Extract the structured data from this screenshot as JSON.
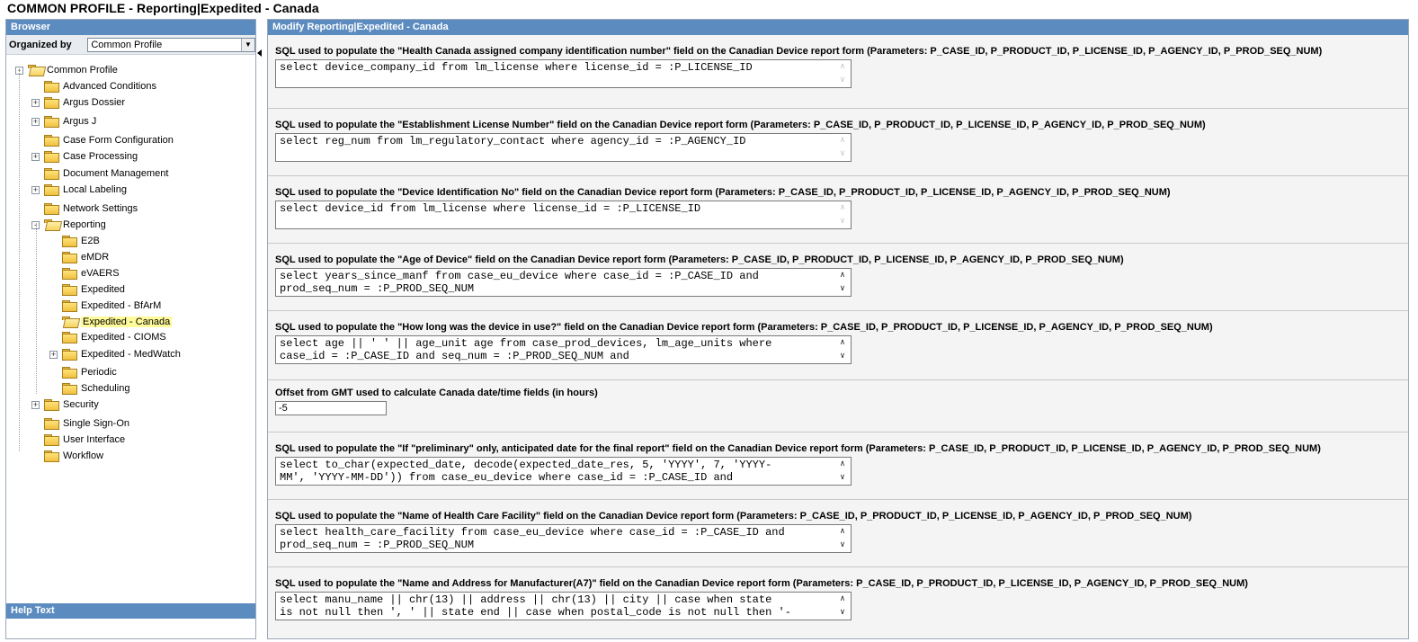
{
  "page_title": "COMMON PROFILE - Reporting|Expedited - Canada",
  "browser": {
    "header": "Browser",
    "organized_by_label": "Organized by",
    "organized_by_value": "Common Profile",
    "tree": [
      {
        "label": "Common Profile",
        "level": 0,
        "expander": "-",
        "open": true
      },
      {
        "label": "Advanced Conditions",
        "level": 1,
        "expander": ""
      },
      {
        "label": "Argus Dossier",
        "level": 1,
        "expander": "+"
      },
      {
        "label": "Argus J",
        "level": 1,
        "expander": "+"
      },
      {
        "label": "Case Form Configuration",
        "level": 1,
        "expander": ""
      },
      {
        "label": "Case Processing",
        "level": 1,
        "expander": "+"
      },
      {
        "label": "Document Management",
        "level": 1,
        "expander": ""
      },
      {
        "label": "Local Labeling",
        "level": 1,
        "expander": "+"
      },
      {
        "label": "Network Settings",
        "level": 1,
        "expander": ""
      },
      {
        "label": "Reporting",
        "level": 1,
        "expander": "-",
        "open": true
      },
      {
        "label": "E2B",
        "level": 2,
        "expander": ""
      },
      {
        "label": "eMDR",
        "level": 2,
        "expander": ""
      },
      {
        "label": "eVAERS",
        "level": 2,
        "expander": ""
      },
      {
        "label": "Expedited",
        "level": 2,
        "expander": ""
      },
      {
        "label": "Expedited - BfArM",
        "level": 2,
        "expander": ""
      },
      {
        "label": "Expedited - Canada",
        "level": 2,
        "expander": "",
        "open": true,
        "selected": true
      },
      {
        "label": "Expedited - CIOMS",
        "level": 2,
        "expander": ""
      },
      {
        "label": "Expedited - MedWatch",
        "level": 2,
        "expander": "+"
      },
      {
        "label": "Periodic",
        "level": 2,
        "expander": ""
      },
      {
        "label": "Scheduling",
        "level": 2,
        "expander": ""
      },
      {
        "label": "Security",
        "level": 1,
        "expander": "+"
      },
      {
        "label": "Single Sign-On",
        "level": 1,
        "expander": ""
      },
      {
        "label": "User Interface",
        "level": 1,
        "expander": ""
      },
      {
        "label": "Workflow",
        "level": 1,
        "expander": ""
      }
    ],
    "help_header": "Help Text"
  },
  "main": {
    "header": "Modify Reporting|Expedited - Canada",
    "sections": [
      {
        "label": "SQL used to populate the \"Health Canada assigned company identification number\" field on the Canadian Device report form (Parameters: P_CASE_ID, P_PRODUCT_ID, P_LICENSE_ID, P_AGENCY_ID, P_PROD_SEQ_NUM)",
        "value": "select device_company_id from lm_license where license_id = :P_LICENSE_ID",
        "scroll": "disabled"
      },
      {
        "label": "SQL used to populate the \"Establishment License Number\" field on the Canadian Device report form (Parameters: P_CASE_ID, P_PRODUCT_ID, P_LICENSE_ID, P_AGENCY_ID, P_PROD_SEQ_NUM)",
        "value": "select reg_num from lm_regulatory_contact where agency_id = :P_AGENCY_ID",
        "scroll": "disabled"
      },
      {
        "label": "SQL used to populate the \"Device Identification No\" field on the Canadian Device report form (Parameters: P_CASE_ID, P_PRODUCT_ID, P_LICENSE_ID, P_AGENCY_ID, P_PROD_SEQ_NUM)",
        "value": "select device_id from lm_license where license_id = :P_LICENSE_ID",
        "scroll": "disabled"
      },
      {
        "label": "SQL used to populate the \"Age of Device\" field on the Canadian Device report form (Parameters: P_CASE_ID, P_PRODUCT_ID, P_LICENSE_ID, P_AGENCY_ID, P_PROD_SEQ_NUM)",
        "value": "select years_since_manf from case_eu_device where case_id = :P_CASE_ID and\nprod_seq_num = :P_PROD_SEQ_NUM",
        "scroll": "enabled"
      },
      {
        "label": "SQL used to populate the \"How long was the device in use?\" field on the Canadian Device report form (Parameters: P_CASE_ID, P_PRODUCT_ID, P_LICENSE_ID, P_AGENCY_ID, P_PROD_SEQ_NUM)",
        "value": "select age || ' ' || age_unit age from case_prod_devices, lm_age_units where\ncase_id = :P_CASE_ID and seq_num = :P_PROD_SEQ_NUM and",
        "scroll": "enabled"
      },
      {
        "label": "Offset from GMT used to calculate Canada date/time fields (in hours)",
        "value": "-5",
        "type": "input"
      },
      {
        "label": "SQL used to populate the \"If \"preliminary\" only, anticipated date for the final report\" field on the Canadian Device report form (Parameters: P_CASE_ID, P_PRODUCT_ID, P_LICENSE_ID, P_AGENCY_ID, P_PROD_SEQ_NUM)",
        "value": "select to_char(expected_date, decode(expected_date_res, 5, 'YYYY', 7, 'YYYY-\nMM', 'YYYY-MM-DD')) from case_eu_device where case_id = :P_CASE_ID and",
        "scroll": "enabled"
      },
      {
        "label": "SQL used to populate the \"Name of Health Care Facility\" field on the Canadian Device report form (Parameters: P_CASE_ID, P_PRODUCT_ID, P_LICENSE_ID, P_AGENCY_ID, P_PROD_SEQ_NUM)",
        "value": "select health_care_facility from case_eu_device where case_id = :P_CASE_ID and\nprod_seq_num = :P_PROD_SEQ_NUM",
        "scroll": "enabled"
      },
      {
        "label": "SQL used to populate the \"Name and Address for Manufacturer(A7)\" field on the Canadian Device report form (Parameters: P_CASE_ID, P_PRODUCT_ID, P_LICENSE_ID, P_AGENCY_ID, P_PROD_SEQ_NUM)",
        "value": "select manu_name || chr(13) || address || chr(13) || city || case when state\nis not null then ', ' || state end || case when postal_code is not null then '-",
        "scroll": "enabled"
      }
    ]
  }
}
